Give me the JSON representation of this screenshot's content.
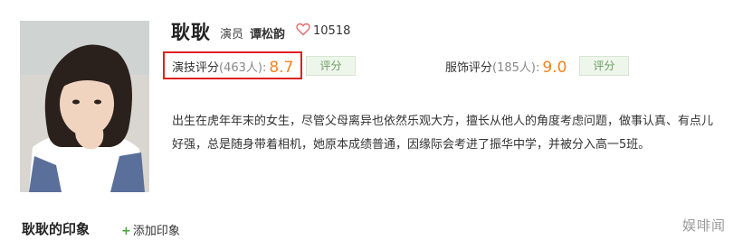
{
  "character": {
    "name": "耿耿",
    "role_label": "演员",
    "actor": "谭松韵",
    "likes": "10518",
    "photo_icon": "character-portrait"
  },
  "ratings": {
    "acting": {
      "label": "演技评分",
      "count": "(463人):",
      "score": "8.7",
      "button": "评分"
    },
    "costume": {
      "label": "服饰评分",
      "count": "(185人):",
      "score": "9.0",
      "button": "评分"
    }
  },
  "description": "出生在虎年年末的女生，尽管父母离异也依然乐观大方，擅长从他人的角度考虑问题，做事认真、有点儿好强，总是随身带着相机，她原本成绩普通，因缘际会考进了振华中学，并被分入高一5班。",
  "impressions": {
    "title": "耿耿的印象",
    "add_label": "添加印象"
  },
  "watermark": "娱啡闻",
  "colors": {
    "score": "#f58220",
    "highlight_border": "#e0201e",
    "button_text": "#6b9c61",
    "button_bg": "#eef6ec"
  }
}
